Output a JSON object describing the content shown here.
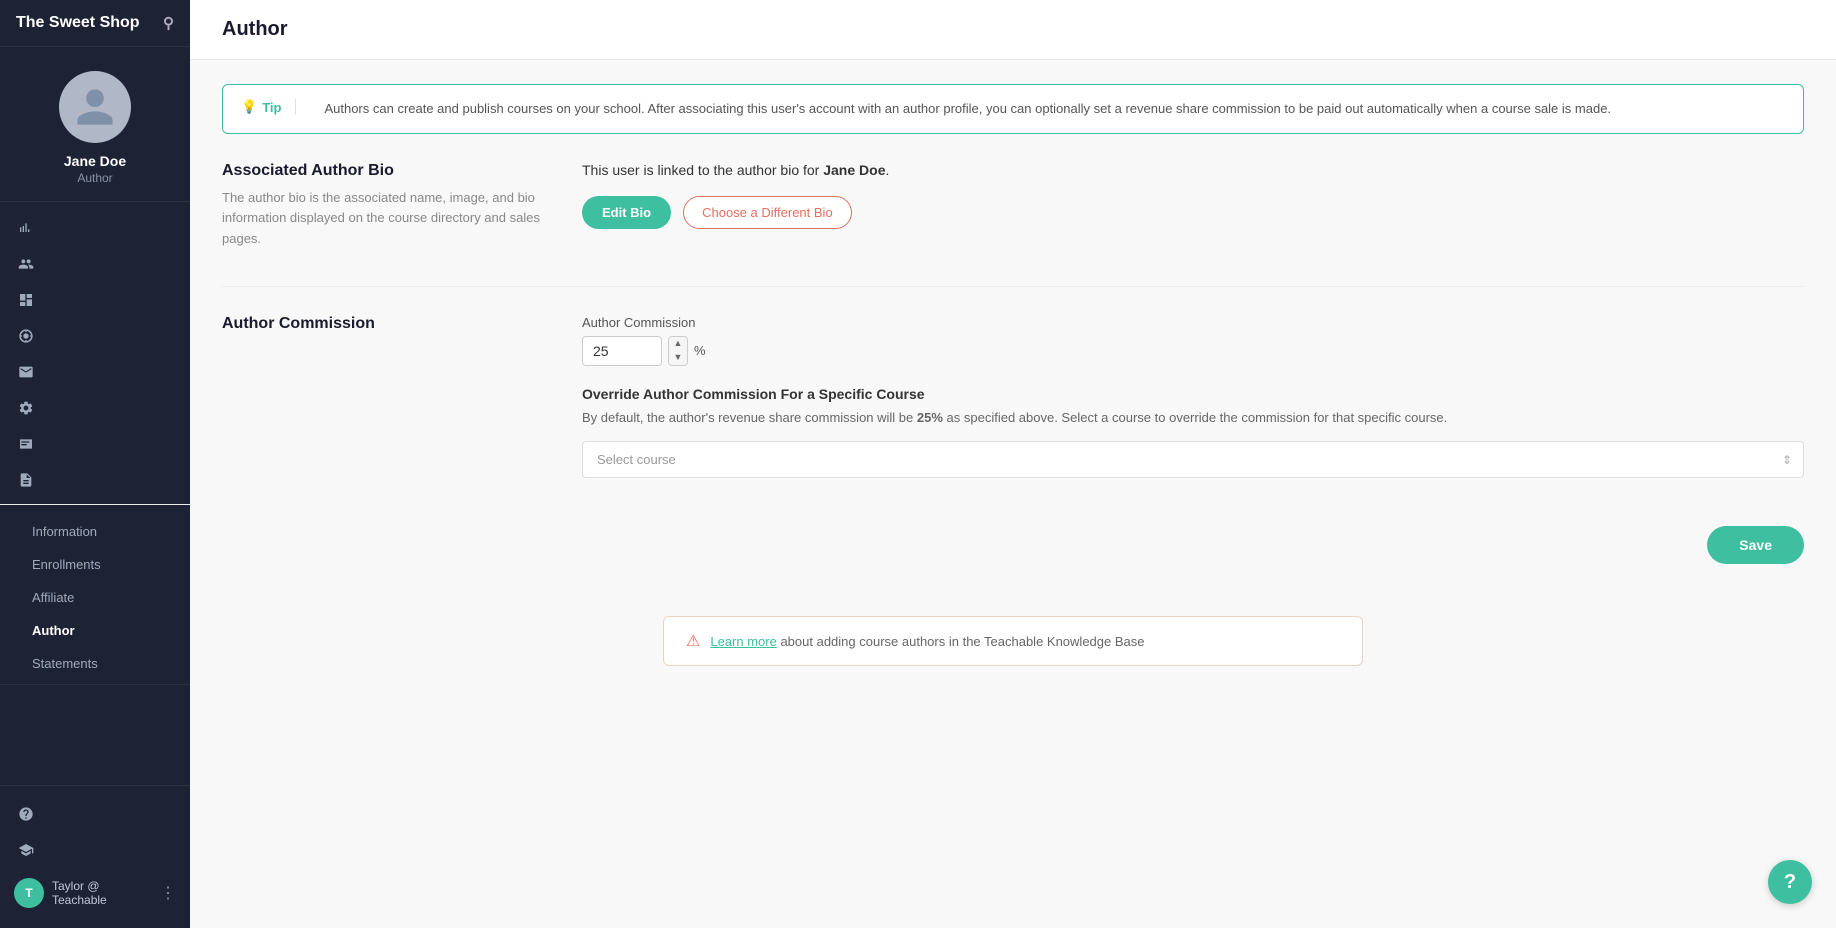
{
  "sidebar": {
    "school_name": "The Sweet Shop",
    "user": {
      "name": "Jane Doe",
      "role": "Author"
    },
    "nav_icons": [
      "chart-line",
      "users",
      "dashboard",
      "dollar",
      "mail",
      "settings",
      "bar-chart",
      "statements"
    ],
    "sub_items": [
      {
        "label": "Information",
        "active": false
      },
      {
        "label": "Enrollments",
        "active": false
      },
      {
        "label": "Affiliate",
        "active": false
      },
      {
        "label": "Author",
        "active": true
      },
      {
        "label": "Statements",
        "active": false
      }
    ],
    "footer_user": "Taylor @ Teachable"
  },
  "main": {
    "title": "Author",
    "tip": {
      "label": "Tip",
      "text": "Authors can create and publish courses on your school. After associating this user's account with an author profile, you can optionally set a revenue share commission to be paid out automatically when a course sale is made."
    },
    "associated_bio": {
      "section_title": "Associated Author Bio",
      "section_desc": "The author bio is the associated name, image, and bio information displayed on the course directory and sales pages.",
      "linked_text_prefix": "This user is linked to the author bio for ",
      "linked_name": "Jane Doe",
      "linked_text_suffix": ".",
      "edit_bio_label": "Edit Bio",
      "choose_bio_label": "Choose a Different Bio"
    },
    "commission": {
      "section_title": "Author Commission",
      "commission_label": "Author Commission",
      "commission_value": "25",
      "commission_pct": "%",
      "override_title": "Override Author Commission For a Specific Course",
      "override_desc_prefix": "By default, the author's revenue share commission will be ",
      "override_bold": "25%",
      "override_desc_suffix": " as specified above. Select a course to override the commission for that specific course.",
      "select_placeholder": "Select course"
    },
    "save_label": "Save",
    "bottom_banner": {
      "text_prefix": "Learn more",
      "text_suffix": " about adding course authors in the Teachable Knowledge Base"
    }
  },
  "help_label": "?"
}
